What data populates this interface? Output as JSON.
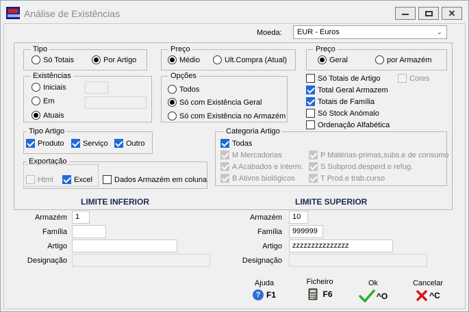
{
  "window": {
    "title": "Análise de Existências",
    "controls": {
      "minimize": "minimize",
      "maximize": "maximize",
      "close": "close"
    }
  },
  "moeda": {
    "label": "Moeda:",
    "value": "EUR - Euros"
  },
  "tipo": {
    "legend": "Tipo",
    "options": [
      {
        "label": "Só Totais",
        "selected": false
      },
      {
        "label": "Por Artigo",
        "selected": true
      }
    ]
  },
  "preco1": {
    "legend": "Preço",
    "options": [
      {
        "label": "Médio",
        "selected": true
      },
      {
        "label": "Ult.Compra (Atual)",
        "selected": false
      }
    ]
  },
  "preco2": {
    "legend": "Preço",
    "options": [
      {
        "label": "Geral",
        "selected": true
      },
      {
        "label": "por Armazém",
        "selected": false
      }
    ]
  },
  "existencias": {
    "legend": "Existências",
    "options": [
      {
        "label": "Iniciais",
        "selected": false
      },
      {
        "label": "Em",
        "selected": false
      },
      {
        "label": "Atuais",
        "selected": true
      }
    ]
  },
  "opcoes": {
    "legend": "Opções",
    "options": [
      {
        "label": "Todos",
        "selected": false
      },
      {
        "label": "Só com Existência Geral",
        "selected": true
      },
      {
        "label": "Só com Existência no Armazém",
        "selected": false
      }
    ]
  },
  "right_checks": {
    "so_totais_artigo": {
      "label": "Só Totais de Artigo",
      "checked": false
    },
    "cores": {
      "label": "Cores",
      "checked": false,
      "disabled": true
    },
    "total_geral_armazem": {
      "label": "Total Geral Armazem",
      "checked": true
    },
    "totais_familia": {
      "label": "Totais de Família",
      "checked": true
    },
    "so_stock_anomalo": {
      "label": "Só Stock Anómalo",
      "checked": false
    },
    "ordenacao_alfabetica": {
      "label": "Ordenação Alfabética",
      "checked": false
    }
  },
  "tipo_artigo": {
    "legend": "Tipo Artigo",
    "items": [
      {
        "label": "Produto",
        "checked": true
      },
      {
        "label": "Serviço",
        "checked": true
      },
      {
        "label": "Outro",
        "checked": true
      }
    ]
  },
  "exportacao": {
    "legend": "Exportação",
    "items": [
      {
        "label": "Html",
        "checked": false,
        "disabled": true
      },
      {
        "label": "Excel",
        "checked": true
      }
    ]
  },
  "dados_armazem": {
    "label": "Dados Armazém em coluna",
    "checked": false
  },
  "categoria": {
    "legend": "Categoria Artigo",
    "todas": {
      "label": "Todas",
      "checked": true
    },
    "items": [
      {
        "label": "M  Mercadorias",
        "checked": true
      },
      {
        "label": "A  Acabados e interm.",
        "checked": true
      },
      {
        "label": "B  Ativos biológicos",
        "checked": true
      },
      {
        "label": "P  Matérias-primas,subs.e de consumo",
        "checked": true
      },
      {
        "label": "S  Subprod.desperd.e refug.",
        "checked": true
      },
      {
        "label": "T  Prod.e trab.curso",
        "checked": true
      }
    ]
  },
  "limite_inferior": {
    "title": "LIMITE INFERIOR",
    "armazem": {
      "label": "Armazém",
      "value": "1"
    },
    "familia": {
      "label": "Família",
      "value": ""
    },
    "artigo": {
      "label": "Artigo",
      "value": ""
    },
    "designacao": {
      "label": "Designação",
      "value": ""
    }
  },
  "limite_superior": {
    "title": "LIMITE SUPERIOR",
    "armazem": {
      "label": "Armazém",
      "value": "10"
    },
    "familia": {
      "label": "Família",
      "value": "999999"
    },
    "artigo": {
      "label": "Artigo",
      "value": "zzzzzzzzzzzzzzz"
    },
    "designacao": {
      "label": "Designação",
      "value": ""
    }
  },
  "actions": {
    "ajuda": {
      "caption": "Ajuda",
      "key": "F1",
      "icon": "help-icon"
    },
    "ficheiro": {
      "caption": "Ficheiro",
      "key": "F6",
      "icon": "calculator-icon"
    },
    "ok": {
      "caption": "Ok",
      "key": "^O",
      "icon": "checkmark-icon",
      "color": "#2cae2c"
    },
    "cancelar": {
      "caption": "Cancelar",
      "key": "^C",
      "icon": "x-icon",
      "color": "#d01818"
    }
  }
}
